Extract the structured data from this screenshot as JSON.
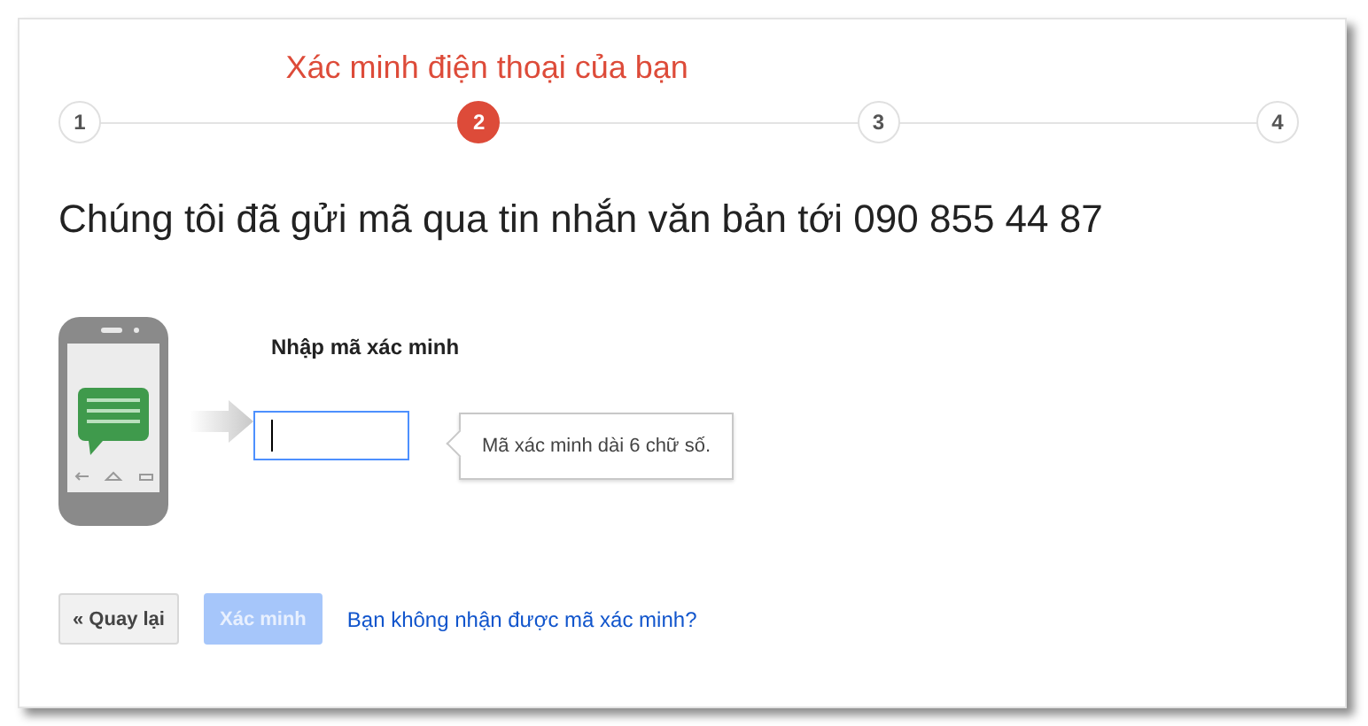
{
  "steps": [
    {
      "label": "1",
      "selected": false
    },
    {
      "label": "2",
      "selected": true,
      "title": "Xác minh điện thoại của bạn"
    },
    {
      "label": "3",
      "selected": false
    },
    {
      "label": "4",
      "selected": false
    }
  ],
  "heading": "Chúng tôi đã gửi mã qua tin nhắn văn bản tới 090 855 44 87",
  "code_field": {
    "label": "Nhập mã xác minh",
    "focused": true
  },
  "hint": "Mã xác minh dài 6 chữ số.",
  "buttons": [
    {
      "label": "« Quay lại",
      "disabled": false,
      "kind": "secondary"
    },
    {
      "label": "Xác minh",
      "disabled": true,
      "kind": "primary"
    }
  ],
  "link": "Bạn không nhận được mã xác minh?"
}
